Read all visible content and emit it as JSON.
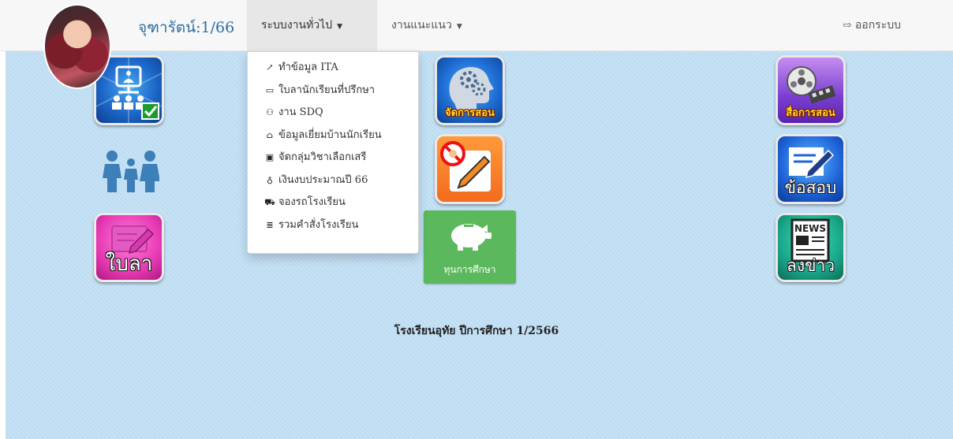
{
  "navbar": {
    "brand": "จุฑารัตน์:1/66",
    "menus": [
      {
        "label": "ระบบงานทั่วไป",
        "active": true
      },
      {
        "label": "งานแนะแนว",
        "active": false
      }
    ],
    "logout": "ออกระบบ"
  },
  "dropdown": {
    "items": [
      {
        "icon": "wrench-icon",
        "label": "ทำข้อมูล ITA"
      },
      {
        "icon": "id-card-icon",
        "label": "ใบลานักเรียนที่ปรึกษา"
      },
      {
        "icon": "people-icon",
        "label": "งาน SDQ"
      },
      {
        "icon": "home-icon",
        "label": "ข้อมูลเยี่ยมบ้านนักเรียน"
      },
      {
        "icon": "book-icon",
        "label": "จัดกลุ่มวิชาเลือกเสรี"
      },
      {
        "icon": "money-bag-icon",
        "label": "เงินงบประมาณปี 66"
      },
      {
        "icon": "car-icon",
        "label": "จองรถโรงเรียน"
      },
      {
        "icon": "document-icon",
        "label": "รวมคำสั่งโรงเรียน"
      }
    ]
  },
  "tiles": {
    "teaching": "จัดการสอน",
    "media": "สื่อการสอน",
    "exam": "ข้อสอบ",
    "leave": "ใบลา",
    "news": "ลงข่าว",
    "news_banner": "NEWS",
    "scholarship": "ทุนการศึกษา"
  },
  "footer": "โรงเรียนอุทัย ปีการศึกษา 1/2566"
}
